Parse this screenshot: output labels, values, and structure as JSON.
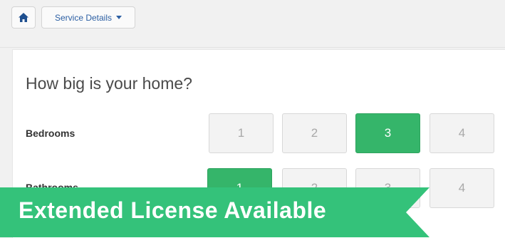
{
  "toolbar": {
    "home_icon": "home-icon",
    "dropdown_label": "Service Details",
    "dropdown_icon": "caret-down-icon"
  },
  "main": {
    "question": "How big is your home?",
    "rows": [
      {
        "label": "Bedrooms",
        "options": [
          "1",
          "2",
          "3",
          "4"
        ],
        "selected": "3"
      },
      {
        "label": "Bathrooms",
        "options": [
          "1",
          "2",
          "3",
          "4"
        ],
        "selected": "1"
      }
    ]
  },
  "banner": {
    "text": "Extended License Available",
    "color": "#34c27a"
  },
  "colors": {
    "selected": "#35b56a",
    "unselected": "#f3f3f3",
    "link": "#2c5fa3"
  }
}
